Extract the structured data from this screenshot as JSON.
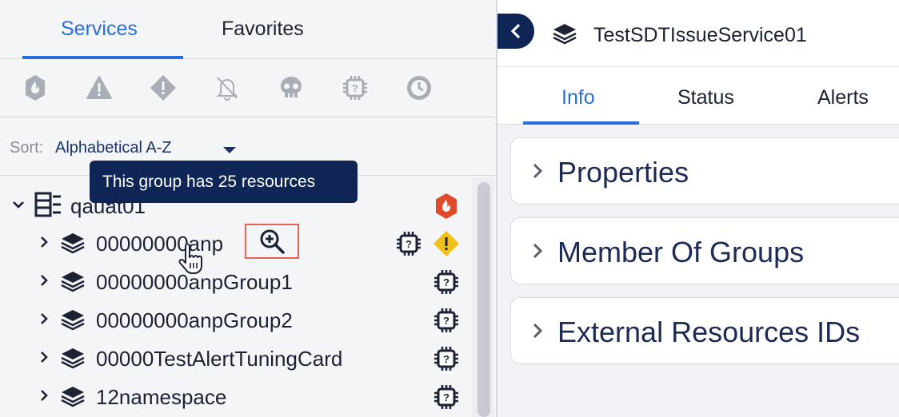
{
  "left_panel": {
    "tabs": [
      {
        "label": "Services",
        "active": true
      },
      {
        "label": "Favorites",
        "active": false
      }
    ],
    "filter_icons": [
      "critical-fire-icon",
      "warning-triangle-icon",
      "error-diamond-icon",
      "bell-off-icon",
      "skull-icon",
      "unknown-chip-icon",
      "clock-icon"
    ],
    "sort": {
      "label": "Sort:",
      "value": "Alphabetical A-Z"
    },
    "tooltip": "This group has 25 resources",
    "tree": [
      {
        "label": "qauat01",
        "expanded": true,
        "type": "group",
        "status": "critical"
      },
      {
        "label": "00000000anp",
        "expanded": false,
        "type": "service",
        "status": "warning",
        "extra": "unknown"
      },
      {
        "label": "00000000anpGroup1",
        "expanded": false,
        "type": "service",
        "status": "unknown"
      },
      {
        "label": "00000000anpGroup2",
        "expanded": false,
        "type": "service",
        "status": "unknown"
      },
      {
        "label": "00000TestAlertTuningCard",
        "expanded": false,
        "type": "service",
        "status": "unknown"
      },
      {
        "label": "12namespace",
        "expanded": false,
        "type": "service",
        "status": "unknown"
      }
    ]
  },
  "right_panel": {
    "title": "TestSDTIssueService01",
    "tabs": [
      {
        "label": "Info",
        "active": true
      },
      {
        "label": "Status",
        "active": false
      },
      {
        "label": "Alerts",
        "active": false
      }
    ],
    "sections": [
      {
        "label": "Properties"
      },
      {
        "label": "Member Of Groups"
      },
      {
        "label": "External Resources IDs"
      }
    ]
  },
  "colors": {
    "accent": "#2a6ed8",
    "navy": "#0f2555",
    "critical": "#e0492a",
    "warning": "#f2c21b",
    "highlight_box": "#e8625a"
  }
}
